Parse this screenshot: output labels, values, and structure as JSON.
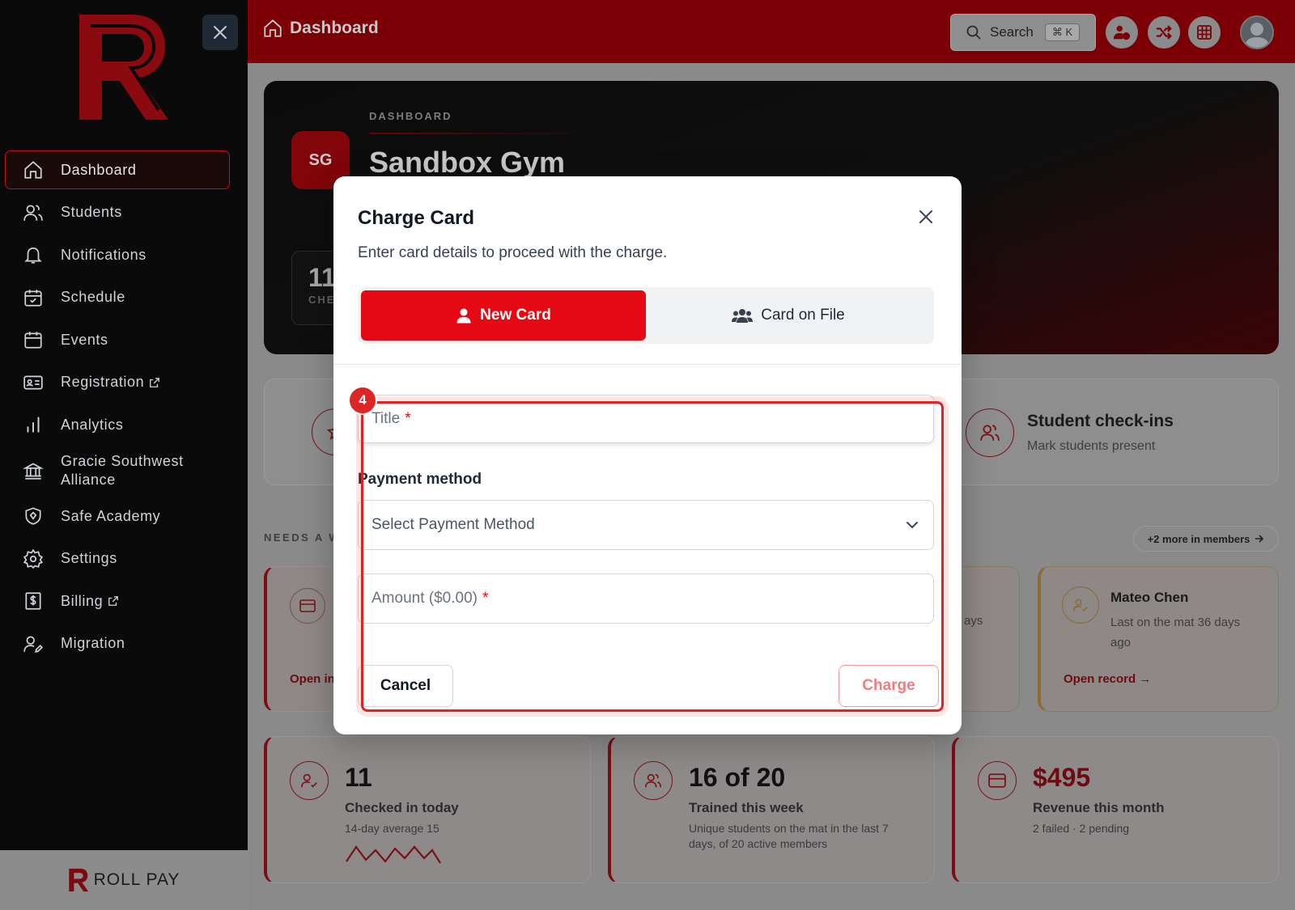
{
  "sidebar": {
    "brand_footer": "ROLL PAY",
    "items": [
      {
        "label": "Dashboard",
        "icon": "home-icon"
      },
      {
        "label": "Students",
        "icon": "users-icon"
      },
      {
        "label": "Notifications",
        "icon": "bell-icon"
      },
      {
        "label": "Schedule",
        "icon": "calendar-check-icon"
      },
      {
        "label": "Events",
        "icon": "calendar-icon"
      },
      {
        "label": "Registration",
        "icon": "id-card-icon"
      },
      {
        "label": "Analytics",
        "icon": "bar-chart-icon"
      },
      {
        "label": "Gracie Southwest Alliance",
        "icon": "bank-icon"
      },
      {
        "label": "Safe Academy",
        "icon": "shield-icon"
      },
      {
        "label": "Settings",
        "icon": "gear-icon"
      },
      {
        "label": "Billing",
        "icon": "dollar-icon"
      },
      {
        "label": "Migration",
        "icon": "user-edit-icon"
      }
    ]
  },
  "header": {
    "title": "Dashboard",
    "search_label": "Search",
    "search_kbd": "⌘ K"
  },
  "hero": {
    "eyebrow": "DASHBOARD",
    "initials": "SG",
    "gym_name": "Sandbox Gym",
    "stat_value": "11",
    "stat_label": "CHE"
  },
  "quick_action": {
    "title": "Student check-ins",
    "subtitle": "Mark students present"
  },
  "attention": {
    "section_label": "NEEDS A WO",
    "more_label": "+2 more in members",
    "partial_link": "Open in",
    "partial_text": "ays",
    "member_name": "Mateo Chen",
    "member_text": "Last on the mat 36 days ago",
    "member_link": "Open record"
  },
  "stats": [
    {
      "value": "11",
      "label": "Checked in today",
      "sub": "14-day average 15"
    },
    {
      "value": "16 of 20",
      "label": "Trained this week",
      "sub": "Unique students on the mat in the last 7 days, of 20 active members"
    },
    {
      "value": "$495",
      "label": "Revenue this month",
      "sub": "2 failed · 2 pending"
    }
  ],
  "modal": {
    "title": "Charge Card",
    "description": "Enter card details to proceed with the charge.",
    "tabs": [
      {
        "label": "New Card",
        "active": true
      },
      {
        "label": "Card on File",
        "active": false
      }
    ],
    "title_placeholder": "Title",
    "payment_method_label": "Payment method",
    "payment_method_placeholder": "Select Payment Method",
    "amount_placeholder": "Amount ($0.00)",
    "required_mark": "*",
    "cancel_label": "Cancel",
    "charge_label": "Charge"
  },
  "annotation": {
    "step": "4"
  },
  "colors": {
    "brand": "#e50914",
    "sidebar_bg": "#0a0a0a",
    "header_bg": "#7a0006"
  }
}
